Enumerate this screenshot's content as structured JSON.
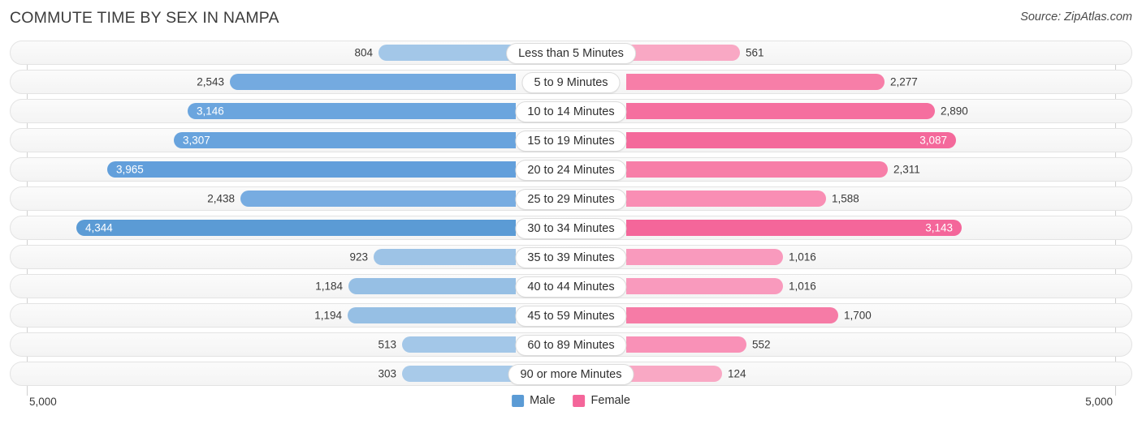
{
  "header": {
    "title": "COMMUTE TIME BY SEX IN NAMPA",
    "source": "Source: ZipAtlas.com"
  },
  "axis": {
    "left_label": "5,000",
    "right_label": "5,000",
    "max": 5000
  },
  "legend": {
    "items": [
      {
        "label": "Male",
        "color": "#5b9bd5"
      },
      {
        "label": "Female",
        "color": "#f4669a"
      }
    ]
  },
  "colors": {
    "male_light": "#a3c7e8",
    "male_mid": "#7fb0e0",
    "male_dark": "#5b9bd5",
    "female_light": "#f9a8c4",
    "female_mid": "#f786ad",
    "female_dark": "#f4669a",
    "row_bg": "#f6f6f6",
    "row_border": "#e3e3e3"
  },
  "chart_data": {
    "type": "bar",
    "title": "COMMUTE TIME BY SEX IN NAMPA",
    "subtitle": "",
    "xlabel": "",
    "ylabel": "",
    "orientation": "horizontal-diverging",
    "xlim": [
      0,
      5000
    ],
    "grid": false,
    "legend_position": "bottom-center",
    "categories": [
      "Less than 5 Minutes",
      "5 to 9 Minutes",
      "10 to 14 Minutes",
      "15 to 19 Minutes",
      "20 to 24 Minutes",
      "25 to 29 Minutes",
      "30 to 34 Minutes",
      "35 to 39 Minutes",
      "40 to 44 Minutes",
      "45 to 59 Minutes",
      "60 to 89 Minutes",
      "90 or more Minutes"
    ],
    "series": [
      {
        "name": "Male",
        "values": [
          804,
          2543,
          3146,
          3307,
          3965,
          2438,
          4344,
          923,
          1184,
          1194,
          513,
          303
        ],
        "labels": [
          "804",
          "2,543",
          "3,146",
          "3,307",
          "3,965",
          "2,438",
          "4,344",
          "923",
          "1,184",
          "1,194",
          "513",
          "303"
        ]
      },
      {
        "name": "Female",
        "values": [
          561,
          2277,
          2890,
          3087,
          2311,
          1588,
          3143,
          1016,
          1016,
          1700,
          552,
          124
        ],
        "labels": [
          "561",
          "2,277",
          "2,890",
          "3,087",
          "2,311",
          "1,588",
          "3,143",
          "1,016",
          "1,016",
          "1,700",
          "552",
          "124"
        ]
      }
    ]
  },
  "rows": [
    {
      "category": "Less than 5 Minutes",
      "male": {
        "label": "804",
        "value": 804,
        "px": 169,
        "color": "#a3c7e8",
        "inside": false
      },
      "female": {
        "label": "561",
        "value": 561,
        "px": 140,
        "color": "#f9a8c4",
        "inside": false
      }
    },
    {
      "category": "5 to 9 Minutes",
      "male": {
        "label": "2,543",
        "value": 2543,
        "px": 352,
        "color": "#74aae0",
        "inside": false
      },
      "female": {
        "label": "2,277",
        "value": 2277,
        "px": 318,
        "color": "#f77ea8",
        "inside": false
      }
    },
    {
      "category": "10 to 14 Minutes",
      "male": {
        "label": "3,146",
        "value": 3146,
        "px": 404,
        "color": "#6ba5de",
        "inside": true
      },
      "female": {
        "label": "2,890",
        "value": 2890,
        "px": 380,
        "color": "#f56f9f",
        "inside": false
      }
    },
    {
      "category": "15 to 19 Minutes",
      "male": {
        "label": "3,307",
        "value": 3307,
        "px": 421,
        "color": "#68a3dd",
        "inside": true
      },
      "female": {
        "label": "3,087",
        "value": 3087,
        "px": 406,
        "color": "#f4699b",
        "inside": true
      }
    },
    {
      "category": "20 to 24 Minutes",
      "male": {
        "label": "3,965",
        "value": 3965,
        "px": 503,
        "color": "#629fdb",
        "inside": true
      },
      "female": {
        "label": "2,311",
        "value": 2311,
        "px": 322,
        "color": "#f77ea8",
        "inside": false
      }
    },
    {
      "category": "25 to 29 Minutes",
      "male": {
        "label": "2,438",
        "value": 2438,
        "px": 339,
        "color": "#77ace1",
        "inside": false
      },
      "female": {
        "label": "1,588",
        "value": 1588,
        "px": 246,
        "color": "#f98eb4",
        "inside": false
      }
    },
    {
      "category": "30 to 34 Minutes",
      "male": {
        "label": "4,344",
        "value": 4344,
        "px": 541,
        "color": "#5b9bd5",
        "inside": true
      },
      "female": {
        "label": "3,143",
        "value": 3143,
        "px": 413,
        "color": "#f4669a",
        "inside": true
      }
    },
    {
      "category": "35 to 39 Minutes",
      "male": {
        "label": "923",
        "value": 923,
        "px": 175,
        "color": "#9dc3e6",
        "inside": false
      },
      "female": {
        "label": "1,016",
        "value": 1016,
        "px": 193,
        "color": "#f99abd",
        "inside": false
      }
    },
    {
      "category": "40 to 44 Minutes",
      "male": {
        "label": "1,184",
        "value": 1184,
        "px": 206,
        "color": "#96bfe4",
        "inside": false
      },
      "female": {
        "label": "1,016",
        "value": 1016,
        "px": 193,
        "color": "#f99abd",
        "inside": false
      }
    },
    {
      "category": "45 to 59 Minutes",
      "male": {
        "label": "1,194",
        "value": 1194,
        "px": 207,
        "color": "#96bfe4",
        "inside": false
      },
      "female": {
        "label": "1,700",
        "value": 1700,
        "px": 261,
        "color": "#f67ba6",
        "inside": false
      }
    },
    {
      "category": "60 to 89 Minutes",
      "male": {
        "label": "513",
        "value": 513,
        "px": 140,
        "color": "#a3c7e8",
        "inside": false
      },
      "female": {
        "label": "552",
        "value": 552,
        "px": 148,
        "color": "#f991b7",
        "inside": false
      }
    },
    {
      "category": "90 or more Minutes",
      "male": {
        "label": "303",
        "value": 303,
        "px": 140,
        "color": "#a8cae9",
        "inside": false
      },
      "female": {
        "label": "124",
        "value": 124,
        "px": 118,
        "color": "#f9a8c4",
        "inside": false
      }
    }
  ]
}
